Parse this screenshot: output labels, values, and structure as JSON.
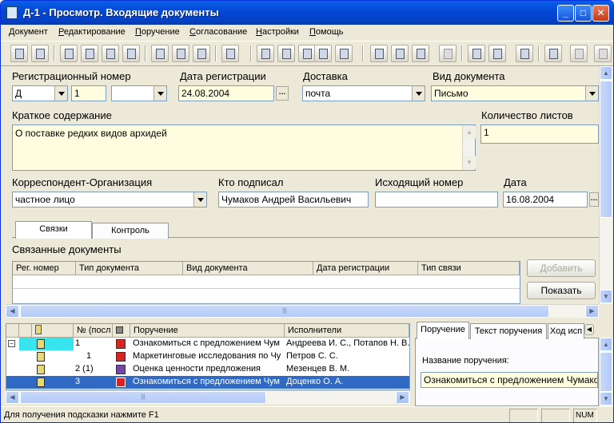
{
  "window": {
    "title": "Д-1 - Просмотр. Входящие документы",
    "min": "_",
    "max": "□",
    "close": "✕"
  },
  "menu": [
    "Документ",
    "Редактирование",
    "Поручение",
    "Согласование",
    "Настройки",
    "Помощь"
  ],
  "form": {
    "reg_number_label": "Регистрационный номер",
    "reg_prefix": "Д",
    "reg_number": "1",
    "reg_suffix": "",
    "reg_date_label": "Дата регистрации",
    "reg_date": "24.08.2004",
    "delivery_label": "Доставка",
    "delivery": "почта",
    "doc_type_label": "Вид документа",
    "doc_type": "Письмо",
    "summary_label": "Краткое содержание",
    "summary": "О поставке редких видов архидей",
    "sheets_label": "Количество листов",
    "sheets": "1",
    "correspondent_label": "Корреспондент-Организация",
    "correspondent": "частное лицо",
    "signed_label": "Кто подписал",
    "signed": "Чумаков Андрей Васильевич",
    "outgoing_label": "Исходящий номер",
    "outgoing": "",
    "date_label": "Дата",
    "date": "16.08.2004"
  },
  "tabs": {
    "links": "Связки",
    "control": "Контроль"
  },
  "linked": {
    "title": "Связанные документы",
    "columns": [
      "Рег. номер",
      "Тип документа",
      "Вид документа",
      "Дата регистрации",
      "Тип связи"
    ],
    "add": "Добавить",
    "show": "Показать"
  },
  "assign_grid": {
    "columns": [
      "№ (посл",
      "Поручение",
      "Исполнители"
    ],
    "rows": [
      {
        "num": "1",
        "task": "Ознакомиться с предложением Чум",
        "execs": "Андреева И. С., Потапов Н. В."
      },
      {
        "num": "1",
        "task": "Маркетинговые исследования по Чу",
        "execs": "Петров С. С."
      },
      {
        "num": "2 (1)",
        "task": "Оценка ценности предложения",
        "execs": "Мезенцев В. М."
      },
      {
        "num": "3",
        "task": "Ознакомиться с предложением Чум",
        "execs": "Доценко О. А."
      }
    ]
  },
  "right_panel": {
    "tabs": [
      "Поручение",
      "Текст поручения",
      "Ход исп"
    ],
    "name_label": "Название поручения:",
    "name_value": "Ознакомиться с предложением Чумакова"
  },
  "status": {
    "hint": "Для получения подсказки нажмите F1",
    "num": "NUM"
  },
  "colors": {
    "title_bar": "#0447d4",
    "selection": "#316ac5",
    "field_yellow": "#fffde0"
  }
}
